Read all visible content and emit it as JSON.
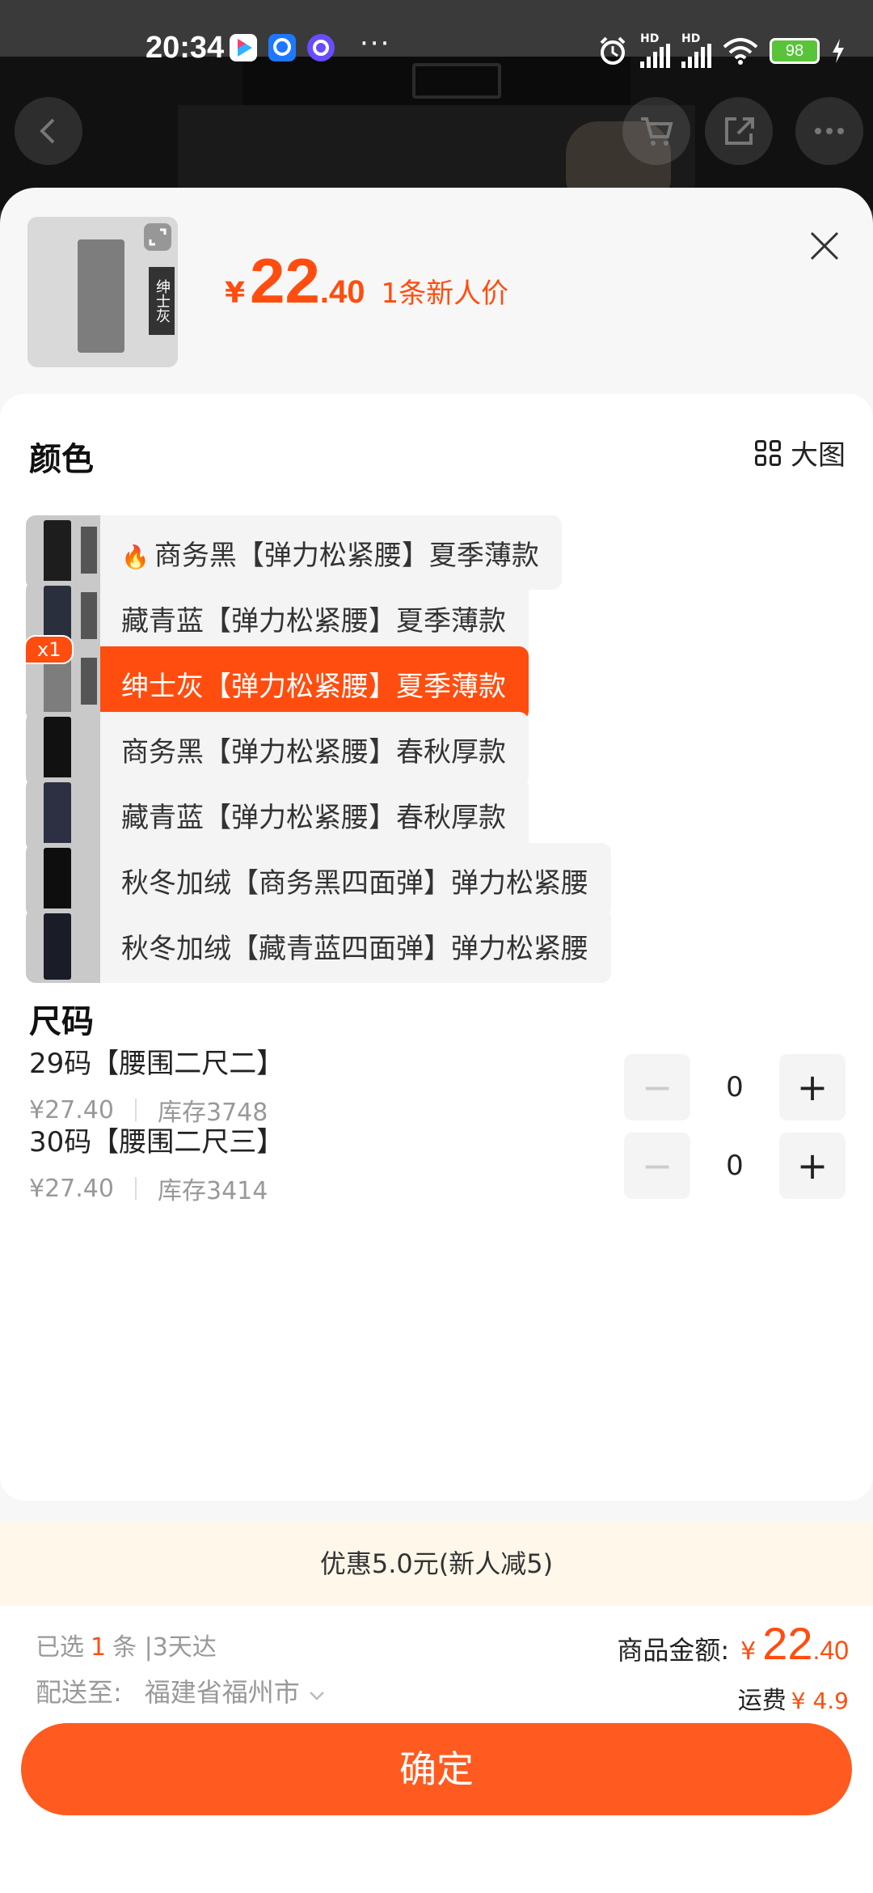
{
  "status_bar": {
    "time": "20:34",
    "more": "···",
    "battery": "98",
    "hd1": "HD",
    "hd2": "HD"
  },
  "header": {
    "price_symbol": "¥",
    "price_int": "22",
    "price_dec": ".40",
    "price_note": "1条新人价",
    "thumb_tag": "绅士灰"
  },
  "color_section": {
    "title": "颜色",
    "big_image_label": "大图",
    "options": [
      {
        "label": "商务黑【弹力松紧腰】夏季薄款",
        "hot": true
      },
      {
        "label": "藏青蓝【弹力松紧腰】夏季薄款"
      },
      {
        "label": "绅士灰【弹力松紧腰】夏季薄款",
        "selected": true,
        "badge": "x1"
      },
      {
        "label": "商务黑【弹力松紧腰】春秋厚款"
      },
      {
        "label": "藏青蓝【弹力松紧腰】春秋厚款"
      },
      {
        "label": "秋冬加绒【商务黑四面弹】弹力松紧腰"
      },
      {
        "label": "秋冬加绒【藏青蓝四面弹】弹力松紧腰"
      }
    ]
  },
  "size_section": {
    "title": "尺码",
    "sizes": [
      {
        "name": "29码【腰围二尺二】",
        "price": "¥27.40",
        "stock": "库存3748",
        "qty": "0"
      },
      {
        "name": "30码【腰围二尺三】",
        "price": "¥27.40",
        "stock": "库存3414",
        "qty": "0"
      }
    ]
  },
  "promo": "优惠5.0元(新人减5)",
  "footer": {
    "selected_prefix": "已选",
    "selected_count": "1",
    "selected_suffix": "条 |3天达",
    "ship_label": "配送至:",
    "ship_to": "福建省福州市",
    "amount_label": "商品金额:",
    "amount_symbol": "¥",
    "amount_int": "22",
    "amount_dec": ".40",
    "freight_label": "运费",
    "freight_value": "¥ 4.9",
    "confirm": "确定"
  },
  "colors": {
    "accent": "#ff4d0f",
    "button": "#ff5a1f",
    "promo_bg": "#fff7ea"
  }
}
